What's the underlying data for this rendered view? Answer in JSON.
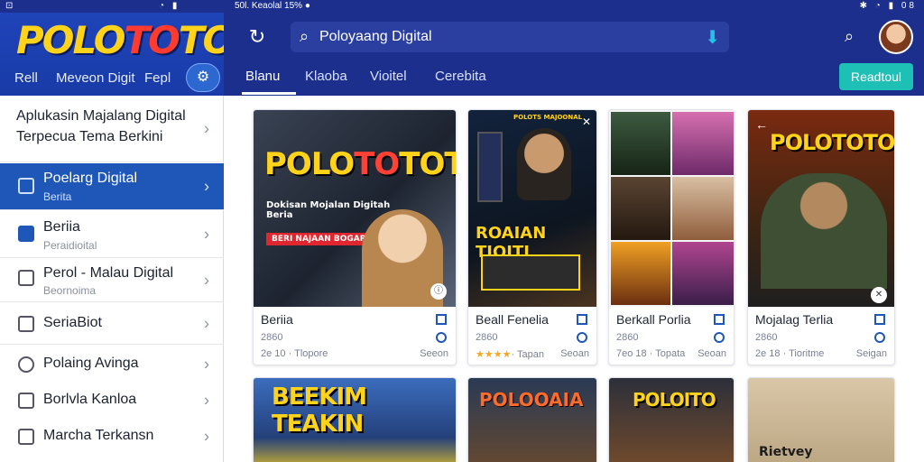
{
  "status": {
    "left": "⊡",
    "mid": "◔ ▮",
    "left_text": "50l. Keaolal 15% ●",
    "right": "✱ ◔ ▮ 08"
  },
  "left_header": {
    "logo_a": "POLO",
    "logo_b": "TO",
    "logo_c": "TO",
    "tabs": [
      "Rell",
      "Meveon Digit",
      "Fepl"
    ]
  },
  "left_list": {
    "top_line1": "Aplukasin Majalang Digital",
    "top_line2": "Terpecua Tema Berkini",
    "items": [
      {
        "title": "Poelarg Digital",
        "subtitle": "Berita"
      },
      {
        "title": "Beriia",
        "subtitle": "Peraidioital"
      },
      {
        "title": "Perol - Malau Digital",
        "subtitle": "Beornoima"
      },
      {
        "title": "SeriaBiot",
        "subtitle": ""
      },
      {
        "title": "Polaing Avinga",
        "subtitle": ""
      },
      {
        "title": "Borlvla Kanloa",
        "subtitle": ""
      },
      {
        "title": "Marcha Terkansn",
        "subtitle": ""
      }
    ]
  },
  "topbar": {
    "search_value": "Poloyaang Digital"
  },
  "tabs": [
    "Blanu",
    "Klaoba",
    "Vioitel",
    "Cerebita"
  ],
  "cta_label": "Readtoul",
  "cards": [
    {
      "poster_title_a": "POLO",
      "poster_title_b": "TO",
      "poster_title_c": "TOTO",
      "poster_sub": "Dokisan Mojalan Digitah\nBeria",
      "poster_band": "BERI NAJAAN BOGAR",
      "title": "Beriia",
      "meta1": "2860",
      "meta2": "2e 10 · Tlopore",
      "right": "Seeon"
    },
    {
      "poster_title": "ROAIAN TIOITL",
      "poster_top": "POLOTS MAJOONAL",
      "title": "Beall Fenelia",
      "meta1": "2860",
      "stars": "★★★★",
      "meta2": "· Tapan",
      "right": "Seoan"
    },
    {
      "title": "Berkall Porlia",
      "meta1": "2860",
      "meta2": "7eo 18 · Topata",
      "right": "Seoan"
    },
    {
      "poster_title": "POLOTOTO",
      "title": "Mojalag Terlia",
      "meta1": "2860",
      "meta2": "2e 18 · Tioritme",
      "right": "Seigan"
    },
    {
      "poster_title": "BEEKIM TEAKIN"
    },
    {
      "poster_title": "POLOOAIA"
    },
    {
      "poster_title": "POLOITO"
    },
    {
      "poster_title": "Rietvey"
    }
  ]
}
